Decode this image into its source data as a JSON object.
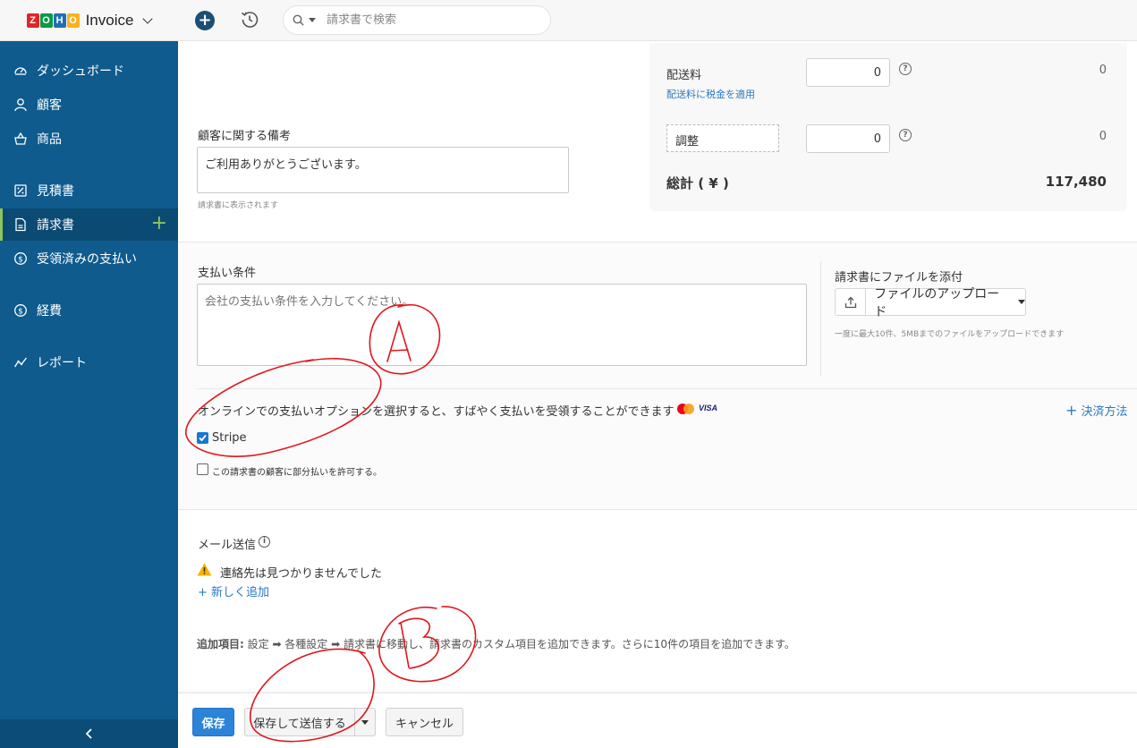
{
  "brand": {
    "logo_letters": [
      "Z",
      "O",
      "H",
      "O"
    ],
    "logo_colors": [
      "#e42527",
      "#089949",
      "#226db4",
      "#f9b21d"
    ],
    "app_name": "Invoice"
  },
  "sidebar": {
    "items": [
      {
        "label": "ダッシュボード",
        "icon": "dashboard-icon"
      },
      {
        "label": "顧客",
        "icon": "user-icon"
      },
      {
        "label": "商品",
        "icon": "basket-icon"
      },
      {
        "label": "見積書",
        "icon": "estimate-icon"
      },
      {
        "label": "請求書",
        "icon": "invoice-icon",
        "active": true
      },
      {
        "label": "受領済みの支払い",
        "icon": "payment-icon"
      },
      {
        "label": "経費",
        "icon": "expense-icon"
      },
      {
        "label": "レポート",
        "icon": "report-icon"
      }
    ],
    "active_accent": "#8ec65b",
    "background": "#0f5b8d"
  },
  "topbar": {
    "search_placeholder": "請求書で検索"
  },
  "summary": {
    "shipping_label": "配送料",
    "shipping_tax_link": "配送料に税金を適用",
    "shipping_value": "0",
    "shipping_amount": "0",
    "adjustment_label": "調整",
    "adjustment_value": "0",
    "adjustment_amount": "0",
    "total_label": "総計 ( ¥ )",
    "total_value": "117,480"
  },
  "customer_notes": {
    "label": "顧客に関する備考",
    "value": "ご利用ありがとうございます。",
    "hint": "請求書に表示されます"
  },
  "terms": {
    "label": "支払い条件",
    "placeholder": "会社の支払い条件を入力してください。"
  },
  "attachment": {
    "label": "請求書にファイルを添付",
    "upload_label": "ファイルのアップロード",
    "hint": "一度に最大10件、5MBまでのファイルをアップロードできます"
  },
  "online_payment": {
    "text": "オンラインでの支払いオプションを選択すると、すばやく支払いを受領することができます",
    "visa": "VISA",
    "payment_method_link": "決済方法",
    "stripe_label": "Stripe",
    "stripe_checked": true,
    "partial_label": "この請求書の顧客に部分払いを許可する。",
    "partial_checked": false
  },
  "email": {
    "label": "メール送信",
    "warning": "連絡先は見つかりませんでした",
    "add_new": "+ 新しく追加"
  },
  "additional": {
    "bold": "追加項目:",
    "text": " 設定 ➡ 各種設定 ➡ 請求書に移動し、請求書のカスタム項目を追加できます。さらに10件の項目を追加できます。"
  },
  "footer": {
    "save": "保存",
    "save_send": "保存して送信する",
    "cancel": "キャンセル"
  },
  "annotations": {
    "a": "A",
    "b": "B",
    "color": "#e0161c"
  }
}
